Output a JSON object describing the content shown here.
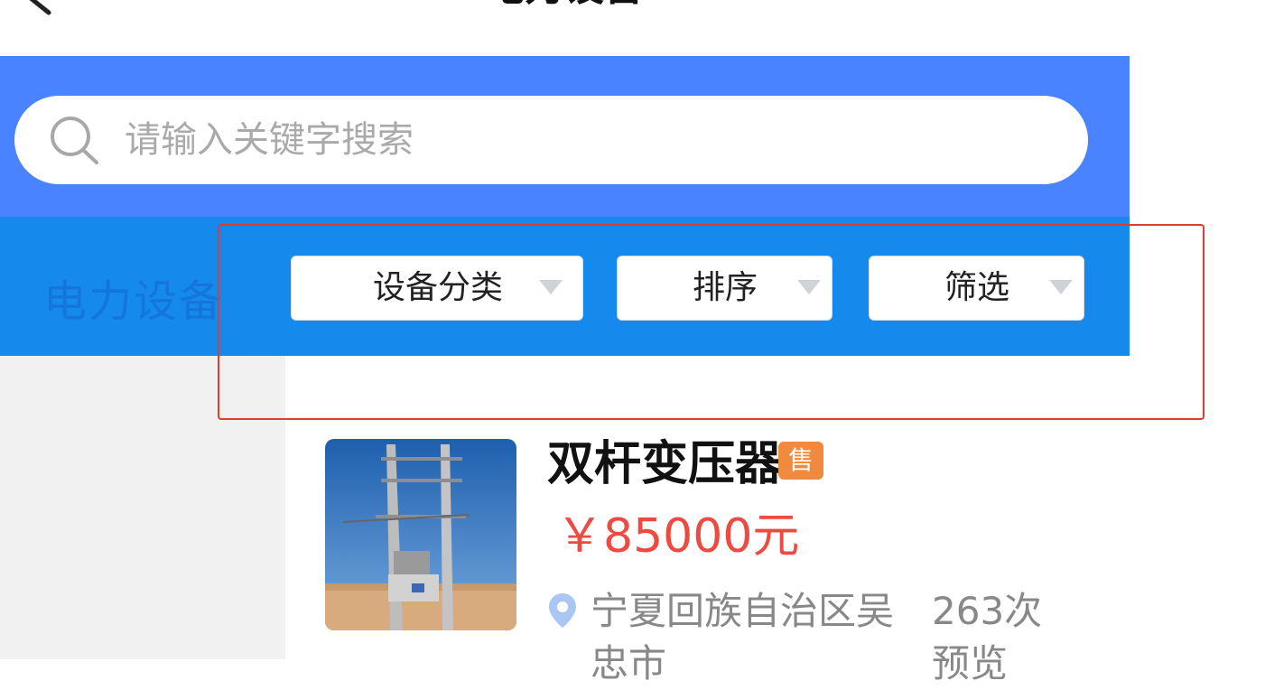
{
  "header": {
    "title": "电力设备"
  },
  "search": {
    "placeholder": "请输入关键字搜索"
  },
  "category_label": "电力设备",
  "filters": [
    {
      "label": "设备分类"
    },
    {
      "label": "排序"
    },
    {
      "label": "筛选"
    }
  ],
  "listing": {
    "title": "双杆变压器",
    "badge": "售",
    "price": "￥85000元",
    "location": "宁夏回族自治区吴忠市",
    "views": "263次预览"
  },
  "colors": {
    "search_band": "#4a83ff",
    "filter_band": "#1589ec",
    "price": "#ee4a42",
    "badge": "#f08a3e",
    "highlight": "#e13c30"
  }
}
